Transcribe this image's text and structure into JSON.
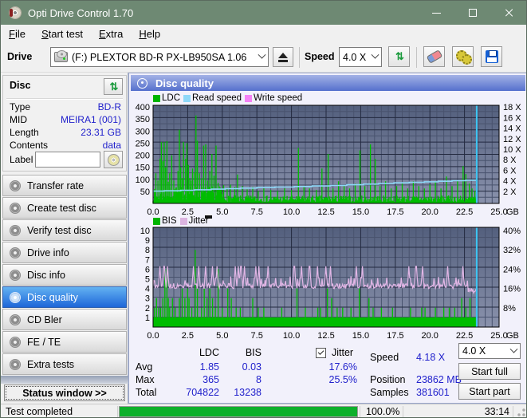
{
  "titlebar": {
    "title": "Opti Drive Control 1.70"
  },
  "menu": {
    "items": [
      "File",
      "Start test",
      "Extra",
      "Help"
    ]
  },
  "toolbar": {
    "drive_label": "Drive",
    "drive_value": "(F:)   PLEXTOR BD-R  PX-LB950SA 1.06",
    "speed_label": "Speed",
    "speed_value": "4.0 X",
    "icons": [
      "optical-drive-icon",
      "eject-icon",
      "refresh-arrows-icon",
      "eraser-icon",
      "gears-icon",
      "floppy-save-icon"
    ]
  },
  "sidebar": {
    "disc_panel": {
      "title": "Disc",
      "rows": [
        {
          "label": "Type",
          "value": "BD-R"
        },
        {
          "label": "MID",
          "value": "MEIRA1 (001)"
        },
        {
          "label": "Length",
          "value": "23.31 GB"
        },
        {
          "label": "Contents",
          "value": "data"
        }
      ],
      "label_caption": "Label",
      "label_value": ""
    },
    "nav": {
      "items": [
        "Transfer rate",
        "Create test disc",
        "Verify test disc",
        "Drive info",
        "Disc info",
        "Disc quality",
        "CD Bler",
        "FE / TE",
        "Extra tests"
      ],
      "selected_index": 5
    },
    "status_window_button": "Status window >>"
  },
  "main": {
    "header": "Disc quality"
  },
  "chart_data": [
    {
      "type": "bar",
      "title": "LDC / Read speed / Write speed vs position",
      "legend": [
        {
          "label": "LDC",
          "color": "#00b400"
        },
        {
          "label": "Read speed",
          "color": "#8ed8f8"
        },
        {
          "label": "Write speed",
          "color": "#f582f5"
        }
      ],
      "x_ticks": [
        "0.0",
        "2.5",
        "5.0",
        "7.5",
        "10.0",
        "12.5",
        "15.0",
        "17.5",
        "20.0",
        "22.5",
        "25.0"
      ],
      "x_unit": "GB",
      "xlim": [
        0,
        25
      ],
      "y_left_ticks": [
        400,
        350,
        300,
        250,
        200,
        150,
        100,
        50
      ],
      "y_left_max": 407,
      "y_right_ticks": [
        "18 X",
        "16 X",
        "14 X",
        "12 X",
        "10 X",
        "8 X",
        "6 X",
        "4 X",
        "2 X"
      ],
      "data_end_gb": 23.38,
      "ldc_spikes": [
        [
          0.1,
          60
        ],
        [
          0.2,
          125
        ],
        [
          0.35,
          95
        ],
        [
          0.5,
          185
        ],
        [
          0.6,
          255
        ],
        [
          0.7,
          175
        ],
        [
          0.8,
          255
        ],
        [
          0.9,
          150
        ],
        [
          1.0,
          258
        ],
        [
          1.1,
          90
        ],
        [
          1.2,
          125
        ],
        [
          1.35,
          200
        ],
        [
          1.5,
          95
        ],
        [
          1.65,
          65
        ],
        [
          1.8,
          135
        ],
        [
          1.9,
          305
        ],
        [
          2.0,
          150
        ],
        [
          2.1,
          105
        ],
        [
          2.2,
          255
        ],
        [
          2.35,
          185
        ],
        [
          2.45,
          250
        ],
        [
          2.55,
          160
        ],
        [
          2.65,
          105
        ],
        [
          2.75,
          95
        ],
        [
          2.85,
          145
        ],
        [
          3.0,
          130
        ],
        [
          3.1,
          365
        ],
        [
          3.2,
          260
        ],
        [
          3.35,
          125
        ],
        [
          3.5,
          105
        ],
        [
          3.65,
          240
        ],
        [
          3.8,
          245
        ],
        [
          3.95,
          95
        ],
        [
          4.1,
          135
        ],
        [
          4.25,
          205
        ],
        [
          4.4,
          115
        ],
        [
          4.55,
          240
        ],
        [
          4.7,
          85
        ],
        [
          4.85,
          65
        ],
        [
          5.1,
          75
        ],
        [
          5.35,
          65
        ],
        [
          5.6,
          78
        ],
        [
          5.9,
          68
        ],
        [
          6.1,
          120
        ],
        [
          6.45,
          72
        ],
        [
          6.8,
          58
        ],
        [
          7.2,
          68
        ],
        [
          7.6,
          52
        ],
        [
          8.0,
          62
        ],
        [
          8.5,
          56
        ],
        [
          9.0,
          52
        ],
        [
          9.5,
          62
        ],
        [
          10.0,
          56
        ],
        [
          10.5,
          230
        ],
        [
          10.9,
          72
        ],
        [
          11.3,
          62
        ],
        [
          11.8,
          56
        ],
        [
          12.2,
          145
        ],
        [
          12.65,
          205
        ],
        [
          13.0,
          62
        ],
        [
          13.4,
          92
        ],
        [
          13.8,
          72
        ],
        [
          14.2,
          62
        ],
        [
          14.6,
          82
        ],
        [
          14.95,
          220
        ],
        [
          15.3,
          72
        ],
        [
          15.7,
          245
        ],
        [
          16.05,
          185
        ],
        [
          16.4,
          72
        ],
        [
          16.8,
          92
        ],
        [
          17.2,
          62
        ],
        [
          17.6,
          72
        ],
        [
          18.0,
          82
        ],
        [
          18.4,
          62
        ],
        [
          18.8,
          92
        ],
        [
          19.2,
          72
        ],
        [
          19.6,
          62
        ],
        [
          20.0,
          78
        ],
        [
          20.4,
          92
        ],
        [
          20.8,
          62
        ],
        [
          21.2,
          112
        ],
        [
          21.6,
          72
        ],
        [
          22.0,
          92
        ],
        [
          22.4,
          155
        ],
        [
          22.6,
          122
        ],
        [
          22.85,
          82
        ],
        [
          23.05,
          62
        ],
        [
          23.25,
          52
        ]
      ],
      "read_speed_points": [
        [
          0,
          2.05
        ],
        [
          0.8,
          2.1
        ],
        [
          2.0,
          2.2
        ],
        [
          3.0,
          2.3
        ],
        [
          4.2,
          2.42
        ],
        [
          5.2,
          2.52
        ],
        [
          6.3,
          2.62
        ],
        [
          7.5,
          2.72
        ],
        [
          8.8,
          2.82
        ],
        [
          10.2,
          2.92
        ],
        [
          11.5,
          3.02
        ],
        [
          12.8,
          3.12
        ],
        [
          14.0,
          3.25
        ],
        [
          15.2,
          3.38
        ],
        [
          16.3,
          3.5
        ],
        [
          17.4,
          3.62
        ],
        [
          18.5,
          3.72
        ],
        [
          19.6,
          3.82
        ],
        [
          20.6,
          3.92
        ],
        [
          21.6,
          4.02
        ],
        [
          22.6,
          4.12
        ],
        [
          23.35,
          4.2
        ]
      ]
    },
    {
      "type": "bar",
      "title": "BIS / Jitter vs position",
      "legend": [
        {
          "label": "BIS",
          "color": "#00b400"
        },
        {
          "label": "Jitter",
          "color": "#dcb4e0"
        }
      ],
      "x_ticks": [
        "0.0",
        "2.5",
        "5.0",
        "7.5",
        "10.0",
        "12.5",
        "15.0",
        "17.5",
        "20.0",
        "22.5",
        "25.0"
      ],
      "x_unit": "GB",
      "xlim": [
        0,
        25
      ],
      "y_left_ticks": [
        10,
        9,
        8,
        7,
        6,
        5,
        4,
        3,
        2,
        1
      ],
      "y_left_max": 10.33,
      "y_right_ticks": [
        "40%",
        "32%",
        "24%",
        "16%",
        "8%"
      ],
      "data_end_gb": 23.38,
      "bis_band_level": 1,
      "bis_spikes": [
        [
          0.1,
          2
        ],
        [
          0.25,
          3
        ],
        [
          0.4,
          2
        ],
        [
          0.55,
          2
        ],
        [
          0.7,
          3
        ],
        [
          0.85,
          6
        ],
        [
          1.0,
          6
        ],
        [
          1.1,
          3
        ],
        [
          1.2,
          2
        ],
        [
          1.4,
          3
        ],
        [
          1.6,
          2
        ],
        [
          1.9,
          3
        ],
        [
          2.1,
          4
        ],
        [
          2.3,
          3
        ],
        [
          2.5,
          4
        ],
        [
          2.6,
          3
        ],
        [
          2.8,
          2
        ],
        [
          3.05,
          8
        ],
        [
          3.2,
          4
        ],
        [
          3.5,
          2
        ],
        [
          3.7,
          4
        ],
        [
          3.9,
          3
        ],
        [
          4.1,
          4
        ],
        [
          4.3,
          3
        ],
        [
          4.5,
          2
        ],
        [
          4.7,
          6
        ],
        [
          5.0,
          2
        ],
        [
          5.4,
          4
        ],
        [
          5.65,
          3
        ],
        [
          6.0,
          2
        ],
        [
          6.3,
          2
        ],
        [
          7.2,
          3
        ],
        [
          7.6,
          2
        ],
        [
          8.0,
          2
        ],
        [
          9.3,
          2
        ],
        [
          10.4,
          4
        ],
        [
          11.0,
          2
        ],
        [
          11.9,
          2
        ],
        [
          12.1,
          2
        ],
        [
          12.6,
          4
        ],
        [
          12.9,
          3
        ],
        [
          13.3,
          2
        ],
        [
          13.7,
          2
        ],
        [
          14.3,
          2
        ],
        [
          14.9,
          4
        ],
        [
          15.6,
          3
        ],
        [
          15.9,
          2
        ],
        [
          16.5,
          2
        ],
        [
          17.3,
          2
        ],
        [
          18.6,
          2
        ],
        [
          19.4,
          2
        ],
        [
          19.65,
          2
        ],
        [
          20.4,
          2
        ],
        [
          21.0,
          2
        ],
        [
          21.4,
          2
        ],
        [
          21.8,
          2
        ],
        [
          22.3,
          3
        ],
        [
          22.6,
          2
        ],
        [
          22.9,
          3
        ]
      ],
      "jitter_base": 4.25,
      "jitter_spikes": [
        0.5,
        0.8,
        1.05,
        2.9,
        3.3,
        3.8,
        4.3,
        4.6,
        5.95,
        6.15,
        6.35,
        6.6,
        7.4,
        7.65,
        8.3,
        10.2,
        10.7,
        11.3,
        11.9,
        12.5,
        12.8,
        14.7,
        15.1,
        18.5,
        19.0,
        19.45,
        21.3,
        22.4
      ],
      "jitter_spike_value": 6.3
    }
  ],
  "chart_colors": {
    "plot_bg_top": "#535f7d",
    "plot_bg_bottom": "#8a92ac",
    "grid_minor": "#49536e",
    "grid_major": "#232a40",
    "ldc_green": "#00bd00",
    "read_cyan": "#8ed8f8",
    "end_marker_cyan": "#3cc6f4",
    "jitter_pink": "#e2b6e6"
  },
  "stats": {
    "col_headers": [
      "LDC",
      "BIS"
    ],
    "jitter_label": "Jitter",
    "jitter_checked": true,
    "rows": [
      {
        "label": "Avg",
        "ldc": "1.85",
        "bis": "0.03",
        "jitter": "17.6%"
      },
      {
        "label": "Max",
        "ldc": "365",
        "bis": "8",
        "jitter": "25.5%"
      },
      {
        "label": "Total",
        "ldc": "704822",
        "bis": "13238",
        "jitter": ""
      }
    ],
    "speed_label": "Speed",
    "speed_value": "4.18 X",
    "position_label": "Position",
    "position_value": "23862 MB",
    "samples_label": "Samples",
    "samples_value": "381601",
    "speed_select": "4.0 X",
    "start_full": "Start full",
    "start_part": "Start part"
  },
  "statusbar": {
    "status": "Test completed",
    "progress_percent": 100,
    "percent_label": "100.0%",
    "time": "33:14"
  }
}
